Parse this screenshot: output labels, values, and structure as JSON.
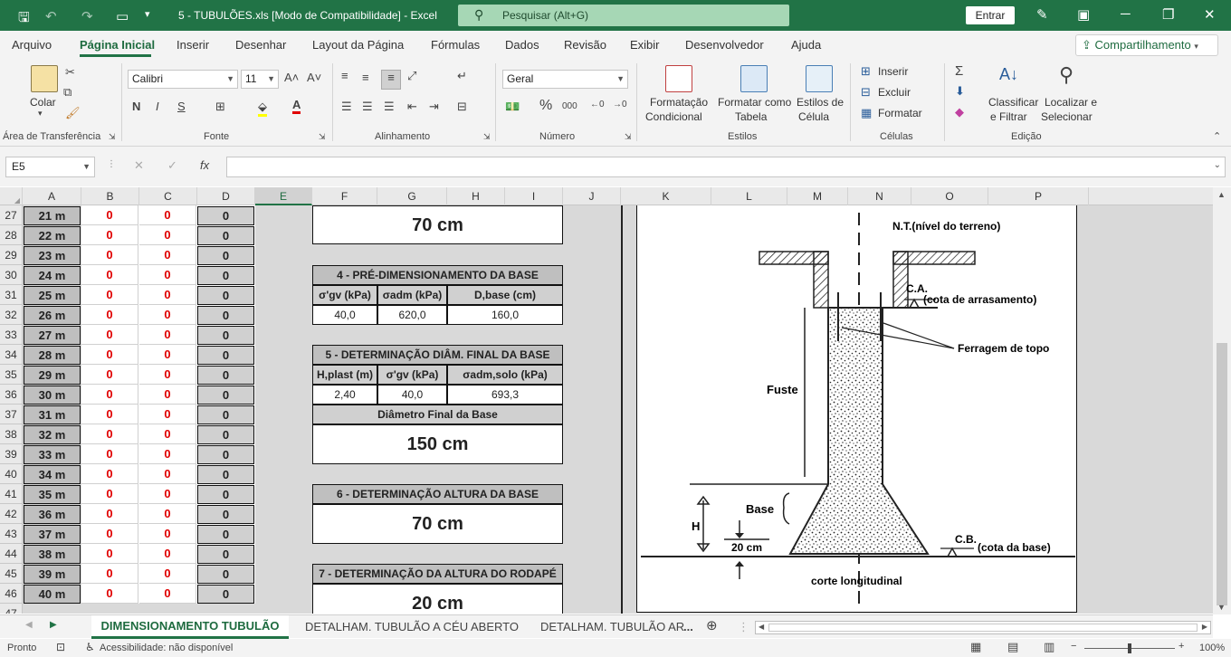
{
  "titlebar": {
    "document": "5 - TUBULÕES.xls  [Modo de Compatibilidade]  -  Excel",
    "search": "Pesquisar (Alt+G)",
    "signin": "Entrar"
  },
  "menu": {
    "tabs": [
      "Arquivo",
      "Página Inicial",
      "Inserir",
      "Desenhar",
      "Layout da Página",
      "Fórmulas",
      "Dados",
      "Revisão",
      "Exibir",
      "Desenvolvedor",
      "Ajuda"
    ],
    "share": "Compartilhamento"
  },
  "ribbon": {
    "groups": {
      "clipboard": "Área de Transferência",
      "font": "Fonte",
      "alignment": "Alinhamento",
      "number": "Número",
      "styles": "Estilos",
      "cells": "Células",
      "editing": "Edição"
    },
    "paste": "Colar",
    "font_name": "Calibri",
    "font_size": "11",
    "bold": "N",
    "italic": "I",
    "underline": "S",
    "number_format": "Geral",
    "cond_format_1": "Formatação",
    "cond_format_2": "Condicional",
    "table_1": "Formatar como",
    "table_2": "Tabela",
    "cellstyles_1": "Estilos de",
    "cellstyles_2": "Célula",
    "insert": "Inserir",
    "delete": "Excluir",
    "format": "Formatar",
    "sort_1": "Classificar",
    "sort_2": "e Filtrar",
    "find_1": "Localizar e",
    "find_2": "Selecionar"
  },
  "formula_bar": {
    "name_box": "E5",
    "fx": "fx",
    "value": ""
  },
  "columns": [
    "A",
    "B",
    "C",
    "D",
    "E",
    "F",
    "G",
    "H",
    "I",
    "J",
    "K",
    "L",
    "M",
    "N",
    "O",
    "P"
  ],
  "rows": [
    {
      "n": "27",
      "a": "21 m",
      "b": "0",
      "c": "0",
      "d": "0"
    },
    {
      "n": "28",
      "a": "22 m",
      "b": "0",
      "c": "0",
      "d": "0"
    },
    {
      "n": "29",
      "a": "23 m",
      "b": "0",
      "c": "0",
      "d": "0"
    },
    {
      "n": "30",
      "a": "24 m",
      "b": "0",
      "c": "0",
      "d": "0"
    },
    {
      "n": "31",
      "a": "25 m",
      "b": "0",
      "c": "0",
      "d": "0"
    },
    {
      "n": "32",
      "a": "26 m",
      "b": "0",
      "c": "0",
      "d": "0"
    },
    {
      "n": "33",
      "a": "27 m",
      "b": "0",
      "c": "0",
      "d": "0"
    },
    {
      "n": "34",
      "a": "28 m",
      "b": "0",
      "c": "0",
      "d": "0"
    },
    {
      "n": "35",
      "a": "29 m",
      "b": "0",
      "c": "0",
      "d": "0"
    },
    {
      "n": "36",
      "a": "30 m",
      "b": "0",
      "c": "0",
      "d": "0"
    },
    {
      "n": "37",
      "a": "31 m",
      "b": "0",
      "c": "0",
      "d": "0"
    },
    {
      "n": "38",
      "a": "32 m",
      "b": "0",
      "c": "0",
      "d": "0"
    },
    {
      "n": "39",
      "a": "33 m",
      "b": "0",
      "c": "0",
      "d": "0"
    },
    {
      "n": "40",
      "a": "34 m",
      "b": "0",
      "c": "0",
      "d": "0"
    },
    {
      "n": "41",
      "a": "35 m",
      "b": "0",
      "c": "0",
      "d": "0"
    },
    {
      "n": "42",
      "a": "36 m",
      "b": "0",
      "c": "0",
      "d": "0"
    },
    {
      "n": "43",
      "a": "37 m",
      "b": "0",
      "c": "0",
      "d": "0"
    },
    {
      "n": "44",
      "a": "38 m",
      "b": "0",
      "c": "0",
      "d": "0"
    },
    {
      "n": "45",
      "a": "39 m",
      "b": "0",
      "c": "0",
      "d": "0"
    },
    {
      "n": "46",
      "a": "40 m",
      "b": "0",
      "c": "0",
      "d": "0"
    },
    {
      "n": "47",
      "a": "",
      "b": "",
      "c": "",
      "d": ""
    }
  ],
  "calc": {
    "top_value": "70 cm",
    "s4": {
      "title": "4 - PRÉ-DIMENSIONAMENTO DA BASE",
      "h1": "σ'gv (kPa)",
      "h2": "σadm (kPa)",
      "h3": "D,base (cm)",
      "v1": "40,0",
      "v2": "620,0",
      "v3": "160,0"
    },
    "s5": {
      "title": "5 - DETERMINAÇÃO DIÂM. FINAL DA BASE",
      "h1": "H,plast (m)",
      "h2": "σ'gv (kPa)",
      "h3": "σadm,solo (kPa)",
      "v1": "2,40",
      "v2": "40,0",
      "v3": "693,3",
      "sub": "Diâmetro Final da Base",
      "result": "150 cm"
    },
    "s6": {
      "title": "6 - DETERMINAÇÃO ALTURA DA BASE",
      "result": "70 cm"
    },
    "s7": {
      "title": "7 - DETERMINAÇÃO DA ALTURA DO RODAPÉ",
      "result": "20 cm"
    }
  },
  "drawing": {
    "nt": "N.T.(nível do terreno)",
    "ca": "C.A.",
    "ca_desc": "(cota de arrasamento)",
    "ferragem": "Ferragem de topo",
    "fuste": "Fuste",
    "base": "Base",
    "h": "H",
    "dim20": "20 cm",
    "cb": "C.B.",
    "cb_desc": "(cota da base)",
    "caption": "corte longitudinal"
  },
  "sheets": {
    "active": "DIMENSIONAMENTO TUBULÃO",
    "tab2": "DETALHAM. TUBULÃO A CÉU ABERTO",
    "tab3": "DETALHAM. TUBULÃO AR",
    "more": "..."
  },
  "status": {
    "ready": "Pronto",
    "accessibility": "Acessibilidade: não disponível",
    "zoom": "100%"
  }
}
